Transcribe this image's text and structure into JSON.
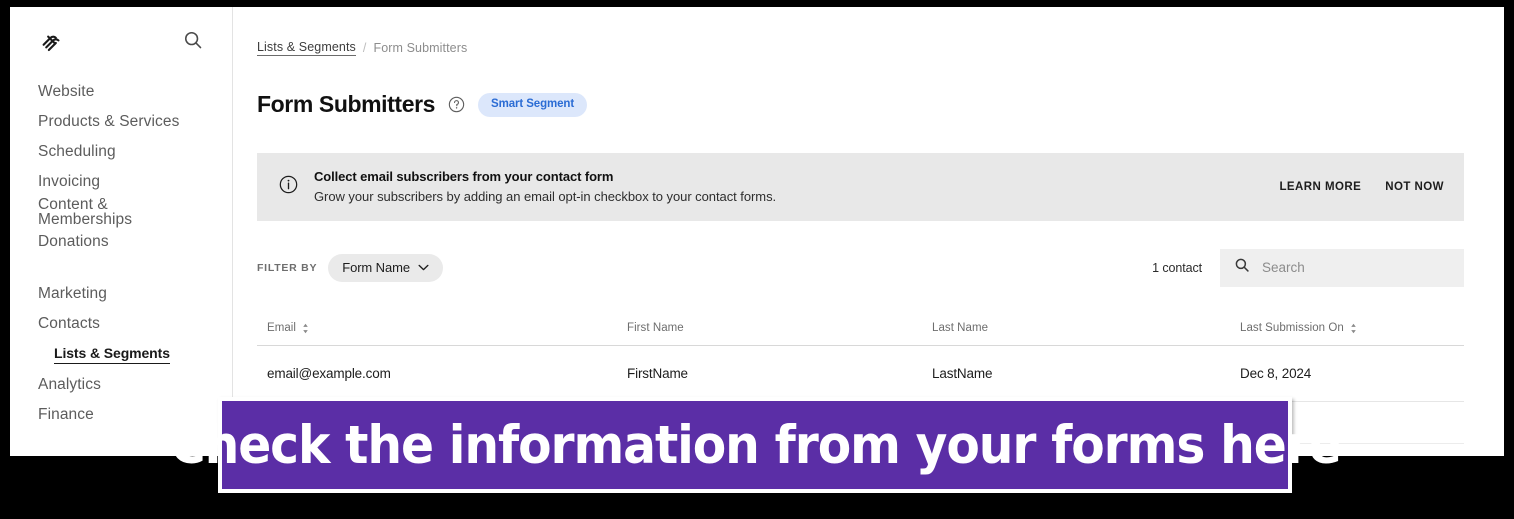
{
  "sidebar": {
    "logo_icon": "squarespace-logo",
    "search_icon": "search-icon",
    "groups": [
      {
        "items": [
          {
            "label": "Website"
          },
          {
            "label": "Products & Services"
          },
          {
            "label": "Scheduling"
          },
          {
            "label": "Invoicing"
          },
          {
            "label": "Content & Memberships"
          },
          {
            "label": "Donations"
          }
        ]
      },
      {
        "items": [
          {
            "label": "Marketing"
          },
          {
            "label": "Contacts"
          }
        ]
      }
    ],
    "sub_item": {
      "label": "Lists & Segments"
    },
    "after_sub_items": [
      {
        "label": "Analytics"
      },
      {
        "label": "Finance"
      }
    ]
  },
  "breadcrumb": {
    "parent": "Lists & Segments",
    "separator": "/",
    "current": "Form Submitters"
  },
  "header": {
    "title": "Form Submitters",
    "help_icon": "question-circle-icon",
    "badge": "Smart Segment",
    "badge_bg": "#dce7fb",
    "badge_color": "#2b6cd4"
  },
  "notice": {
    "icon": "info-circle-icon",
    "title": "Collect email subscribers from your contact form",
    "subtitle": "Grow your subscribers by adding an email opt-in checkbox to your contact forms.",
    "learn_more": "LEARN MORE",
    "not_now": "NOT NOW",
    "bg": "#e8e8e8"
  },
  "filters": {
    "label": "FILTER BY",
    "pill": {
      "label": "Form Name",
      "icon": "chevron-down-icon"
    }
  },
  "toolbar": {
    "contact_count": "1 contact",
    "search": {
      "icon": "search-icon",
      "value": "",
      "placeholder": "Search"
    }
  },
  "table": {
    "columns": [
      {
        "label": "Email",
        "sortable": true,
        "sort_icon": "sort-arrows-icon"
      },
      {
        "label": "First Name",
        "sortable": false
      },
      {
        "label": "Last Name",
        "sortable": false
      },
      {
        "label": "Last Submission On",
        "sortable": true,
        "sort_icon": "sort-arrows-icon"
      }
    ],
    "rows": [
      {
        "email": "email@example.com",
        "first_name": "FirstName",
        "last_name": "LastName",
        "last_submission_on": "Dec 8, 2024"
      }
    ]
  },
  "annotation": {
    "text": "Check the information from your forms here",
    "bg": "#5b2ea6",
    "color": "#ffffff"
  }
}
